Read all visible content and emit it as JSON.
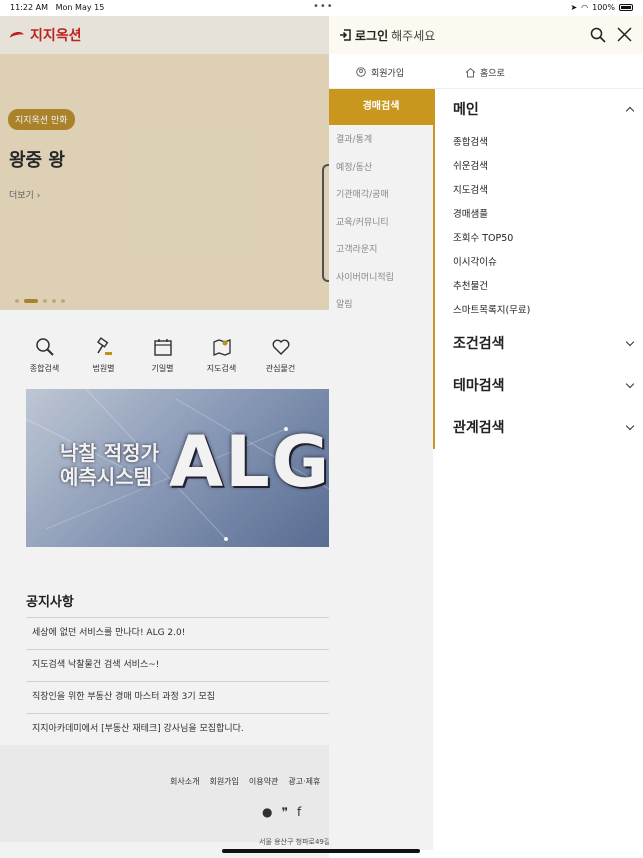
{
  "statusbar": {
    "time": "11:22 AM",
    "date": "Mon May 15",
    "battery": "100%"
  },
  "background": {
    "logo": "지지옥션",
    "hero": {
      "badge": "지지옥션 만화",
      "title": "왕중 왕",
      "more": "더보기"
    },
    "quick_menu": [
      {
        "label": "종합검색",
        "icon": "magnifier-icon"
      },
      {
        "label": "법원별",
        "icon": "gavel-icon"
      },
      {
        "label": "기일별",
        "icon": "calendar-icon"
      },
      {
        "label": "지도검색",
        "icon": "map-icon"
      },
      {
        "label": "관심물건",
        "icon": "heart-icon"
      }
    ],
    "banner": {
      "line1": "낙찰 적정가",
      "line2": "예측시스템",
      "brand": "ALG"
    },
    "notice": {
      "title": "공지사항",
      "items": [
        "세상에 없던 서비스를 만나다! ALG 2.0!",
        "지도검색 낙찰물건 검색 서비스~!",
        "직장인을 위한 부동산 경매 마스터 과정 3기 모집",
        "지지아카데미에서 [부동산 재테크] 강사님을 모집합니다."
      ]
    },
    "footer": {
      "links": [
        "회사소개",
        "회원가입",
        "이용약관",
        "광고·제휴"
      ],
      "address": "서울 용산구 청파로49길"
    }
  },
  "drawer": {
    "login_bold": "로그인",
    "login_rest": "해주세요",
    "join_label": "회원가입",
    "home_label": "홈으로",
    "left_menu": [
      {
        "label": "경매검색",
        "active": true
      },
      {
        "label": "결과/통계",
        "active": false
      },
      {
        "label": "예정/동산",
        "active": false
      },
      {
        "label": "기관매각/공매",
        "active": false
      },
      {
        "label": "교육/커뮤니티",
        "active": false
      },
      {
        "label": "고객라운지",
        "active": false
      },
      {
        "label": "사이버머니적립",
        "active": false
      },
      {
        "label": "알림",
        "active": false
      }
    ],
    "categories": [
      {
        "title": "메인",
        "expanded": true,
        "items": [
          "종합검색",
          "쉬운검색",
          "지도검색",
          "경매샘플",
          "조회수 TOP50",
          "이시각이슈",
          "추천물건",
          "스마트목록지(무료)"
        ]
      },
      {
        "title": "조건검색",
        "expanded": false,
        "items": []
      },
      {
        "title": "테마검색",
        "expanded": false,
        "items": []
      },
      {
        "title": "관계검색",
        "expanded": false,
        "items": []
      }
    ]
  },
  "colors": {
    "accent": "#c9971d",
    "brand_red": "#c8251f",
    "hero_bg": "#e9dcbf"
  }
}
